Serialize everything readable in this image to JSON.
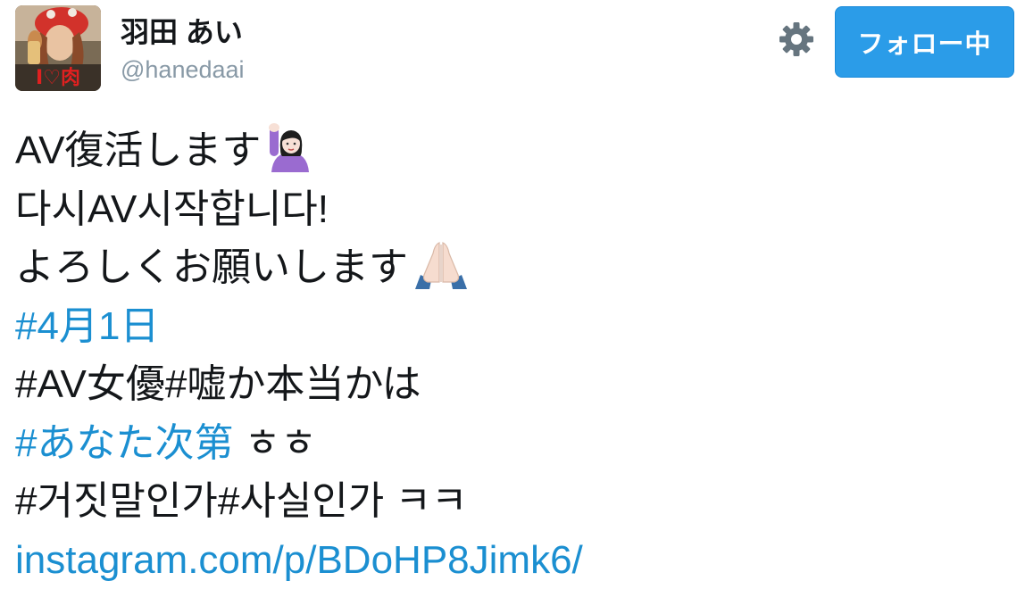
{
  "author": {
    "display_name": "羽田 あい",
    "screen_name": "@hanedaai",
    "avatar_caption": "I♡肉"
  },
  "header": {
    "settings_icon": "gear-icon",
    "follow_button_label": "フォロー中"
  },
  "tweet": {
    "line1_text": "AV復活します",
    "line1_emoji": "person-raising-hand-emoji",
    "line2_text": "다시AV시작합니다!",
    "line3_text": "よろしくお願いします",
    "line3_emoji": "folded-hands-emoji",
    "line4_hashtag": "#4月1日",
    "line5_text": "#AV女優#嘘か本当かは",
    "line6_hashtag": "#あなた次第",
    "line6_suffix": " ㅎㅎ",
    "line7_text": "#거짓말인가#사실인가 ㅋㅋ",
    "line8_link": "instagram.com/p/BDoHP8Jimk6/"
  },
  "colors": {
    "link": "#1b8fd1",
    "follow_button": "#2b9ce8",
    "secondary_text": "#8899a6",
    "icon": "#66757f"
  }
}
